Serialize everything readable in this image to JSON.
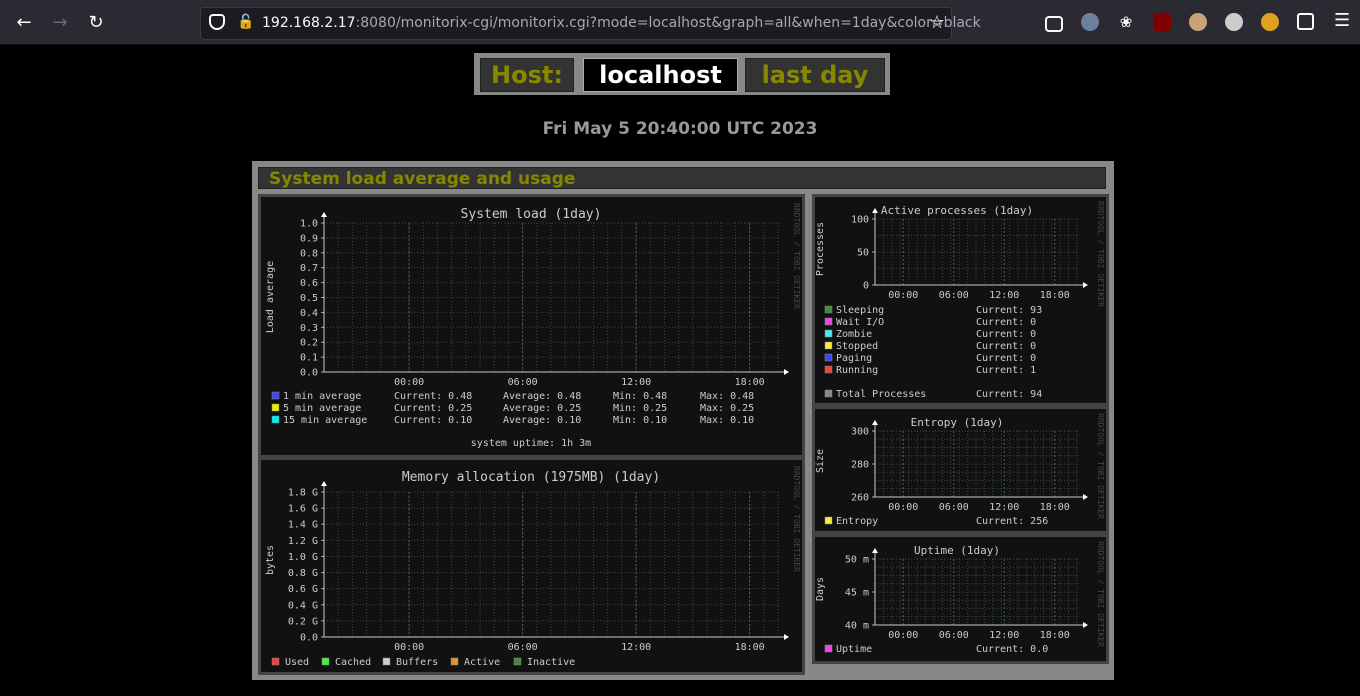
{
  "browser": {
    "url_host": "192.168.2.17",
    "url_rest": ":8080/monitorix-cgi/monitorix.cgi?mode=localhost&graph=all&when=1day&color=black"
  },
  "header": {
    "host_label": "Host:",
    "host_name": "localhost",
    "period": "last day",
    "datetime": "Fri May 5 20:40:00 UTC 2023"
  },
  "section_title": "System load average and usage",
  "watermark": "RRDTOOL / TOBI OETIKER",
  "time_ticks": [
    "00:00",
    "06:00",
    "12:00",
    "18:00"
  ],
  "graphs": {
    "load": {
      "title": "System load  (1day)",
      "ylabel": "Load average",
      "yticks": [
        "1.0",
        "0.9",
        "0.8",
        "0.7",
        "0.6",
        "0.5",
        "0.4",
        "0.3",
        "0.2",
        "0.1",
        "0.0"
      ],
      "legend": [
        {
          "label": "1 min average",
          "color": "#4444ee",
          "current": "Current: 0.48",
          "average": "Average: 0.48",
          "min": "Min: 0.48",
          "max": "Max: 0.48"
        },
        {
          "label": "5 min average",
          "color": "#eeee00",
          "current": "Current: 0.25",
          "average": "Average: 0.25",
          "min": "Min: 0.25",
          "max": "Max: 0.25"
        },
        {
          "label": "15 min average",
          "color": "#00eeee",
          "current": "Current: 0.10",
          "average": "Average: 0.10",
          "min": "Min: 0.10",
          "max": "Max: 0.10"
        }
      ],
      "uptime": "system uptime:  1h 3m"
    },
    "memory": {
      "title": "Memory allocation (1975MB)  (1day)",
      "ylabel": "bytes",
      "yticks": [
        "1.8 G",
        "1.6 G",
        "1.4 G",
        "1.2 G",
        "1.0 G",
        "0.8 G",
        "0.6 G",
        "0.4 G",
        "0.2 G",
        "0.0"
      ],
      "legend": [
        {
          "label": "Used",
          "color": "#ee4444"
        },
        {
          "label": "Cached",
          "color": "#44ee44"
        },
        {
          "label": "Buffers",
          "color": "#cccccc"
        },
        {
          "label": "Active",
          "color": "#e29136"
        },
        {
          "label": "Inactive",
          "color": "#448844"
        }
      ]
    },
    "processes": {
      "title": "Active processes  (1day)",
      "ylabel": "Processes",
      "yticks": [
        "100",
        "50",
        "0"
      ],
      "legend": [
        {
          "label": "Sleeping",
          "color": "#448844",
          "current": "Current:   93"
        },
        {
          "label": "Wait I/O",
          "color": "#ee44ee",
          "current": "Current:    0"
        },
        {
          "label": "Zombie",
          "color": "#44eeee",
          "current": "Current:    0"
        },
        {
          "label": "Stopped",
          "color": "#eeee44",
          "current": "Current:    0"
        },
        {
          "label": "Paging",
          "color": "#4444ee",
          "current": "Current:    0"
        },
        {
          "label": "Running",
          "color": "#ee4444",
          "current": "Current:    1"
        }
      ],
      "total": {
        "label": "Total Processes",
        "color": "#888888",
        "current": "Current:   94"
      }
    },
    "entropy": {
      "title": "Entropy  (1day)",
      "ylabel": "Size",
      "yticks": [
        "300",
        "280",
        "260"
      ],
      "legend": {
        "label": "Entropy",
        "color": "#eeee44",
        "current": "Current:  256"
      }
    },
    "uptime": {
      "title": "Uptime  (1day)",
      "ylabel": "Days",
      "yticks": [
        "50 m",
        "45 m",
        "40 m"
      ],
      "legend": {
        "label": "Uptime",
        "color": "#ee44ee",
        "current": "Current:  0.0"
      }
    }
  },
  "colors": {
    "accent": "#888800",
    "background": "#000000",
    "graph_bg": "#111111",
    "grid": "#446644"
  }
}
